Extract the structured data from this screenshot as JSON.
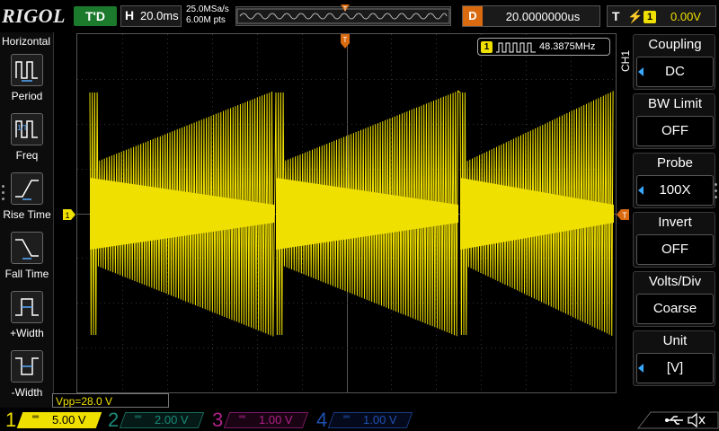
{
  "top": {
    "brand": "RIGOL",
    "run_status": "T'D",
    "timebase_letter": "H",
    "timebase": "20.0ms",
    "sample_rate": "25.0MSa/s",
    "memory_depth": "6.00M pts",
    "delay_letter": "D",
    "delay": "20.0000000us",
    "trigger_letter": "T",
    "trigger_channel": "1",
    "trigger_level": "0.00V"
  },
  "left_panel": {
    "title": "Horizontal",
    "items": [
      {
        "label": "Period",
        "icon": "period-icon"
      },
      {
        "label": "Freq",
        "icon": "freq-icon"
      },
      {
        "label": "Rise Time",
        "icon": "rise-time-icon"
      },
      {
        "label": "Fall Time",
        "icon": "fall-time-icon"
      },
      {
        "label": "+Width",
        "icon": "pos-width-icon"
      },
      {
        "label": "-Width",
        "icon": "neg-width-icon"
      }
    ]
  },
  "screen": {
    "freq_channel": "1",
    "freq_value": "48.3875MHz",
    "ground_marker": "1",
    "trace_color": "#f0e000"
  },
  "right_menu": {
    "channel_tab": "CH1",
    "items": [
      {
        "title": "Coupling",
        "value": "DC"
      },
      {
        "title": "BW Limit",
        "value": "OFF"
      },
      {
        "title": "Probe",
        "value": "100X"
      },
      {
        "title": "Invert",
        "value": "OFF"
      },
      {
        "title": "Volts/Div",
        "value": "Coarse"
      },
      {
        "title": "Unit",
        "value": "[V]"
      }
    ]
  },
  "vpp_readout": "Vpp=28.0 V",
  "bottom": {
    "channels": [
      {
        "num": "1",
        "scale": "5.00 V",
        "color": "#f0e000",
        "active": true
      },
      {
        "num": "2",
        "scale": "2.00 V",
        "color": "#1a8a7a",
        "active": false
      },
      {
        "num": "3",
        "scale": "1.00 V",
        "color": "#b0208a",
        "active": false
      },
      {
        "num": "4",
        "scale": "1.00 V",
        "color": "#2050b0",
        "active": false
      }
    ]
  },
  "colors": {
    "ch1": "#f0e000",
    "accent_orange": "#d96a10",
    "run_green": "#1b7a2c",
    "menu_arrow": "#39a8ff"
  }
}
